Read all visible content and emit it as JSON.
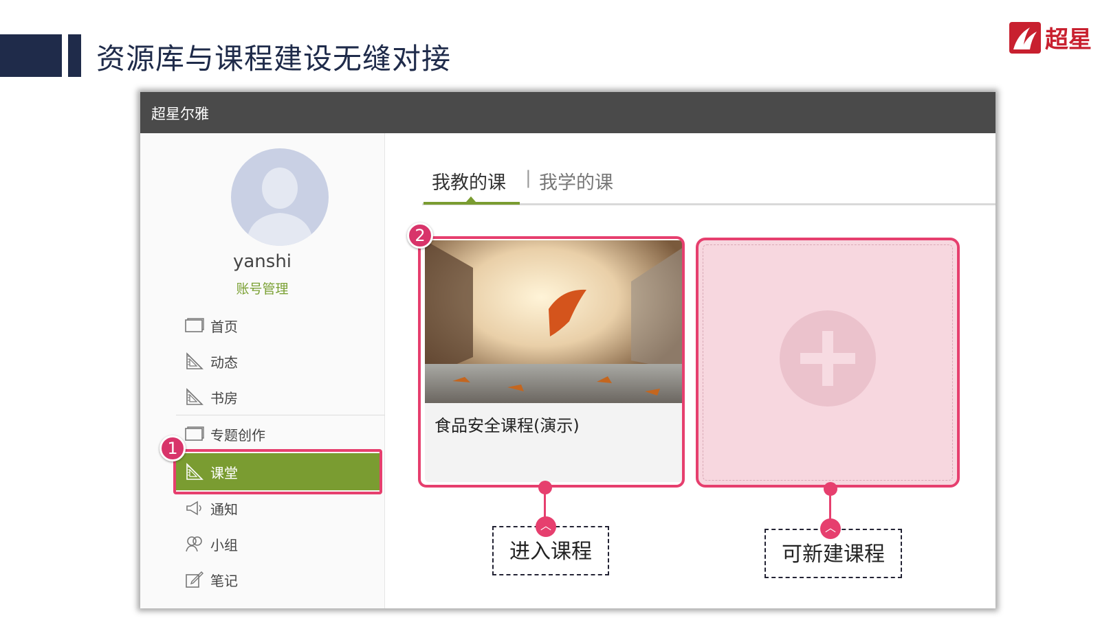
{
  "slide": {
    "title": "资源库与课程建设无缝对接",
    "brand": "超星"
  },
  "window": {
    "title": "超星尔雅"
  },
  "profile": {
    "username": "yanshi",
    "account_link": "账号管理"
  },
  "sidebar": {
    "items": [
      {
        "label": "首页",
        "icon": "window-icon"
      },
      {
        "label": "动态",
        "icon": "triangle-ruler-icon"
      },
      {
        "label": "书房",
        "icon": "triangle-ruler-icon"
      },
      {
        "label": "专题创作",
        "icon": "window-icon"
      },
      {
        "label": "课堂",
        "icon": "triangle-ruler-icon",
        "active": true
      },
      {
        "label": "通知",
        "icon": "megaphone-icon"
      },
      {
        "label": "小组",
        "icon": "users-icon"
      },
      {
        "label": "笔记",
        "icon": "edit-note-icon"
      }
    ]
  },
  "tabs": {
    "teach": "我教的课",
    "separator": "|",
    "learn": "我学的课"
  },
  "course": {
    "title": "食品安全课程(演示)"
  },
  "badges": {
    "one": "1",
    "two": "2"
  },
  "callouts": {
    "enter": "进入课程",
    "create": "可新建课程"
  },
  "colors": {
    "accent_green": "#7a9c31",
    "highlight_pink": "#e63f6e",
    "navy": "#1f2b4a",
    "titlebar": "#4a4a4a"
  }
}
